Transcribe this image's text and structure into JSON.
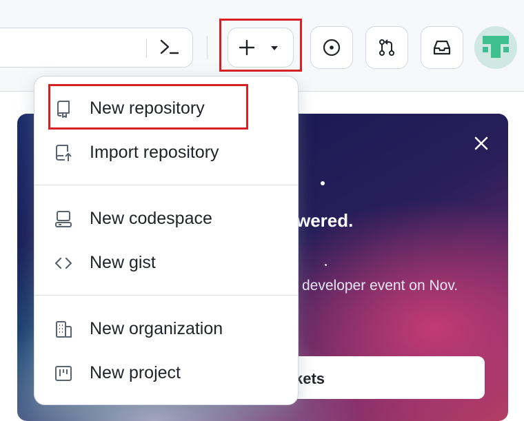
{
  "header": {
    "command_palette_icon": "terminal-icon",
    "create_icon": "plus-icon",
    "create_caret_icon": "triangle-down-icon",
    "issues_icon": "issue-opened-icon",
    "pull_requests_icon": "git-pull-request-icon",
    "inbox_icon": "inbox-icon",
    "avatar_icon": "identicon"
  },
  "menu": {
    "items": [
      {
        "label": "New repository",
        "icon": "repo-icon"
      },
      {
        "label": "Import repository",
        "icon": "repo-push-icon"
      },
      {
        "label": "New codespace",
        "icon": "codespaces-icon"
      },
      {
        "label": "New gist",
        "icon": "code-icon"
      },
      {
        "label": "New organization",
        "icon": "organization-icon"
      },
      {
        "label": "New project",
        "icon": "project-icon"
      }
    ]
  },
  "banner": {
    "headline_fragment": "wered.",
    "subtext_fragment": "developer event on Nov.",
    "button_fragment": "kets",
    "close_icon": "x-icon"
  },
  "colors": {
    "highlight": "#d81f26",
    "header_bg": "#f6f8fa",
    "border": "#d0d7de"
  }
}
